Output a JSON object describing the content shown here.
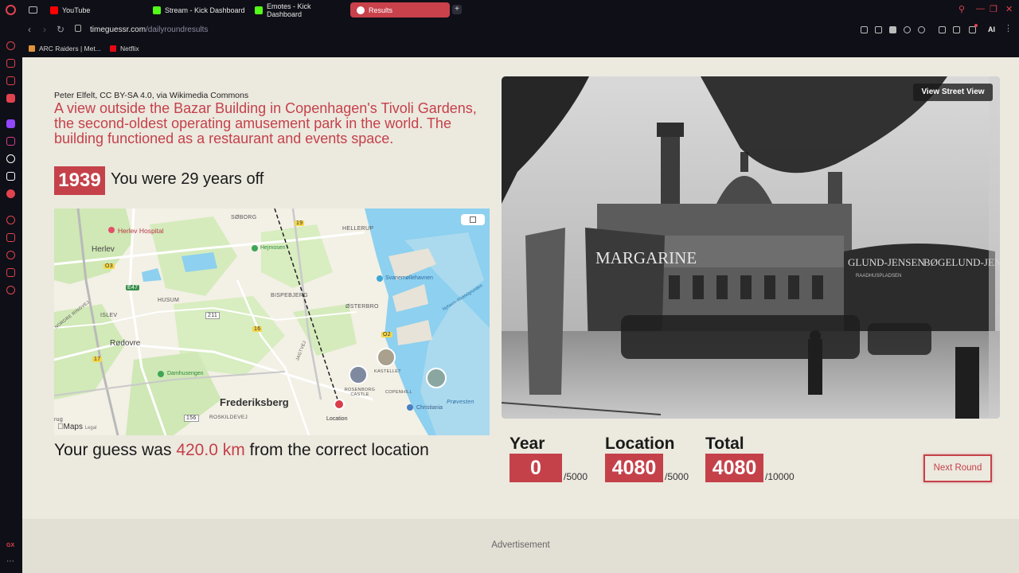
{
  "browser": {
    "tabs": [
      {
        "label": "YouTube",
        "color": "#ff0000"
      },
      {
        "label": "Stream - Kick Dashboard",
        "color": "#53fc18"
      },
      {
        "label": "Emotes - Kick Dashboard",
        "color": "#53fc18"
      },
      {
        "label": "Results",
        "color": "#ffffff",
        "active": true
      }
    ],
    "new_tab": "+",
    "url_host": "timeguessr.com",
    "url_path": "/dailyroundresults",
    "ai_label": "AI",
    "bookmarks": [
      {
        "label": "ARC Raiders | Met...",
        "color": "#e0943a"
      },
      {
        "label": "Netflix",
        "color": "#e50914"
      }
    ],
    "sidebar_bottom_label": "GX"
  },
  "result": {
    "credit": "Peter Elfelt, CC BY-SA 4.0, via Wikimedia Commons",
    "description": "A view outside the Bazar Building in Copenhagen's Tivoli Gardens, the second-oldest operating amusement park in the world. The building functioned as a restaurant and events space.",
    "year": "1939",
    "years_off_text": "You were 29 years off",
    "guess_prefix": "Your guess was ",
    "guess_distance": "420.0 km",
    "guess_suffix": " from the correct location",
    "street_view_label": "View Street View",
    "next_round_label": "Next Round",
    "advertisement_label": "Advertisement"
  },
  "map": {
    "labels": {
      "soborg": "SØBORG",
      "hellerup": "HELLERUP",
      "herlev_hospital": "Herlev Hospital",
      "herlev": "Herlev",
      "hejmosen": "Hejmosen",
      "svanemollehavnen": "Svanemøllehavnen",
      "bispebjerg": "BISPEBJERG",
      "osterbro": "ØSTERBRO",
      "husum": "HUSUM",
      "islev": "ISLEV",
      "rodovre": "Rødovre",
      "damhusengen": "Damhusengen",
      "frederiksberg": "Frederiksberg",
      "roskildevej": "ROSKILDEVEJ",
      "location": "Location",
      "kastellet": "KASTELLET",
      "rosenborg": "ROSENBORG CASTLE",
      "copenhill": "COPENHILL",
      "christiania": "Christiania",
      "provesten": "Prøvesten",
      "nyhavn": "Nyhavn–Middelgrunden",
      "road_19": "19",
      "road_03": "O3",
      "road_e47": "E47",
      "road_211": "211",
      "road_16": "16",
      "road_02": "O2",
      "road_17": "17",
      "road_156": "156",
      "road_vestvej": "NORDRE RINGVEJ",
      "jagtvej": "JAGTVEJ",
      "rug": "rug"
    },
    "attribution": "Maps",
    "legal": "Legal"
  },
  "scores": {
    "year": {
      "label": "Year",
      "value": "0",
      "max": "/5000"
    },
    "location": {
      "label": "Location",
      "value": "4080",
      "max": "/5000"
    },
    "total": {
      "label": "Total",
      "value": "4080",
      "max": "/10000"
    }
  },
  "photo": {
    "sign_left": "MARGARINE",
    "sign_right": "BØGELUND-JENSEN",
    "sign_right_2": "GLUND-JENSEN",
    "sign_sub": "RAADHUSPLADSEN"
  },
  "colors": {
    "accent": "#c5414a",
    "page_bg": "#ece9df",
    "browser_bg": "#0f0f17"
  }
}
